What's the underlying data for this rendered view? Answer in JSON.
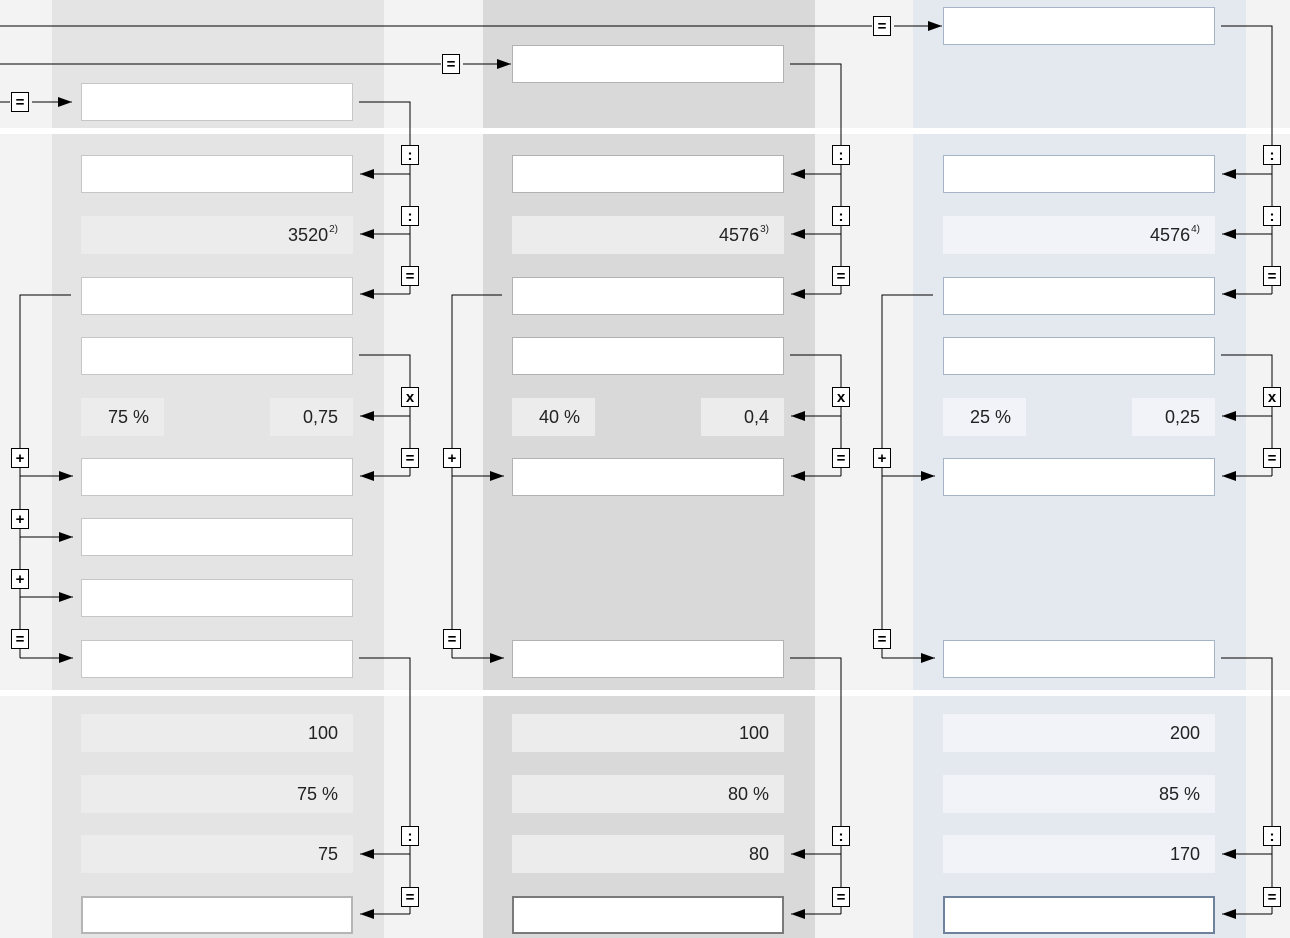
{
  "operators": {
    "divide": ":",
    "equals": "=",
    "multiply": "x",
    "plus": "+"
  },
  "columns": [
    {
      "id": "a",
      "total_value": "3520",
      "total_footnote": "2)",
      "percentage_label": "75 %",
      "factor": "0,75",
      "base": "100",
      "rate": "75 %",
      "divided": "75"
    },
    {
      "id": "b",
      "total_value": "4576",
      "total_footnote": "3)",
      "percentage_label": "40 %",
      "factor": "0,4",
      "base": "100",
      "rate": "80 %",
      "divided": "80"
    },
    {
      "id": "c",
      "total_value": "4576",
      "total_footnote": "4)",
      "percentage_label": "25 %",
      "factor": "0,25",
      "base": "200",
      "rate": "85 %",
      "divided": "170"
    }
  ],
  "colors": {
    "page_bg": "#f3f3f3",
    "column_a_bg": "#e4e4e4",
    "column_b_bg": "#d9d9d9",
    "column_c_bg": "#e4e8ef",
    "value_bg": "#ececec",
    "result_border_a": "#b5b5b5",
    "result_border_b": "#7a7a7a",
    "result_border_c": "#6f829b"
  }
}
